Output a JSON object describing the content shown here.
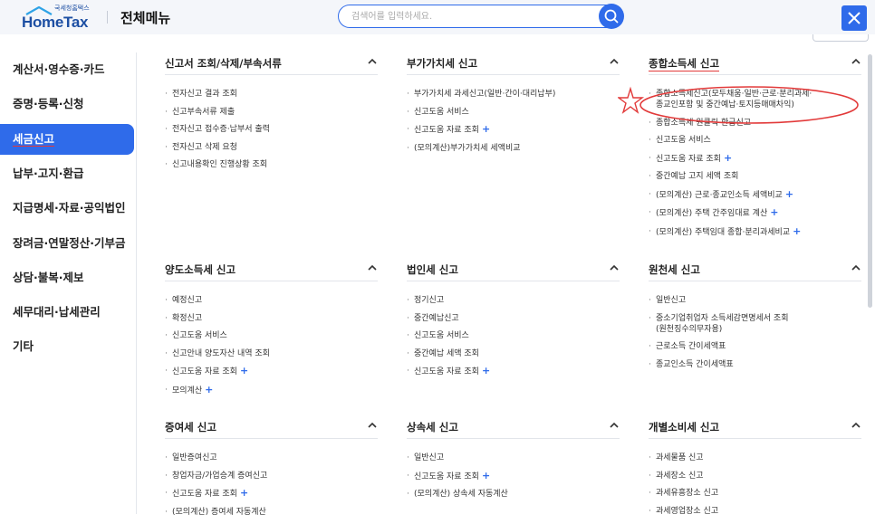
{
  "header": {
    "logo_sub": "국세청홈택스",
    "logo_main": "HomeTax",
    "title": "전체메뉴",
    "search_placeholder": "검색어를 입력하세요."
  },
  "sidebar": {
    "items": [
      {
        "label": "계산서·영수증·카드"
      },
      {
        "label": "증명·등록·신청"
      },
      {
        "label": "세금신고",
        "active": true
      },
      {
        "label": "납부·고지·환급"
      },
      {
        "label": "지급명세·자료·공익법인"
      },
      {
        "label": "장려금·연말정산·기부금"
      },
      {
        "label": "상담·불복·제보"
      },
      {
        "label": "세무대리·납세관리"
      },
      {
        "label": "기타"
      }
    ]
  },
  "sections": [
    {
      "title": "신고서 조회/삭제/부속서류",
      "items": [
        {
          "label": "전자신고 결과 조회"
        },
        {
          "label": "신고부속서류 제출"
        },
        {
          "label": "전자신고 접수증·납부서 출력"
        },
        {
          "label": "전자신고 삭제 요청"
        },
        {
          "label": "신고내용확인 진행상황 조회"
        }
      ]
    },
    {
      "title": "부가가치세 신고",
      "items": [
        {
          "label": "부가가치세 과세신고(일반·간이·대리납부)"
        },
        {
          "label": "신고도움 서비스"
        },
        {
          "label": "신고도움 자료 조회",
          "plus": "+"
        },
        {
          "label": "(모의계산)부가가치세 세액비교"
        }
      ]
    },
    {
      "title": "종합소득세 신고",
      "items": [
        {
          "label": "종합소득세신고(모두채움·일반·근로·분리과세·",
          "label2": "종교인포함 및 중간예납·토지등매매차익)"
        },
        {
          "label": "종합소득세 원클릭 환급신고"
        },
        {
          "label": "신고도움 서비스"
        },
        {
          "label": "신고도움 자료 조회",
          "plus": "+"
        },
        {
          "label": "중간예납 고지 세액 조회"
        },
        {
          "label": "(모의계산) 근로·종교인소득 세액비교",
          "plus": "+"
        },
        {
          "label": "(모의계산) 주택 간주임대료 계산",
          "plus": "+"
        },
        {
          "label": "(모의계산) 주택임대 종합·분리과세비교",
          "plus": "+"
        }
      ]
    },
    {
      "title": "양도소득세 신고",
      "items": [
        {
          "label": "예정신고"
        },
        {
          "label": "확정신고"
        },
        {
          "label": "신고도움 서비스"
        },
        {
          "label": "신고안내 양도자산 내역 조회"
        },
        {
          "label": "신고도움 자료 조회",
          "plus": "+"
        },
        {
          "label": "모의계산",
          "plus": "+"
        }
      ]
    },
    {
      "title": "법인세 신고",
      "items": [
        {
          "label": "정기신고"
        },
        {
          "label": "중간예납신고"
        },
        {
          "label": "신고도움 서비스"
        },
        {
          "label": "중간예납 세액 조회"
        },
        {
          "label": "신고도움 자료 조회",
          "plus": "+"
        }
      ]
    },
    {
      "title": "원천세 신고",
      "items": [
        {
          "label": "일반신고"
        },
        {
          "label": "중소기업취업자 소득세감면명세서 조회",
          "label2": "(원천징수의무자용)"
        },
        {
          "label": "근로소득 간이세액표"
        },
        {
          "label": "종교인소득 간이세액표"
        }
      ]
    },
    {
      "title": "증여세 신고",
      "items": [
        {
          "label": "일반증여신고"
        },
        {
          "label": "창업자금/가업승계 증여신고"
        },
        {
          "label": "신고도움 자료 조회",
          "plus": "+"
        },
        {
          "label": "(모의계산) 증여세 자동계산"
        }
      ]
    },
    {
      "title": "상속세 신고",
      "items": [
        {
          "label": "일반신고"
        },
        {
          "label": "신고도움 자료 조회",
          "plus": "+"
        },
        {
          "label": "(모의계산) 상속세 자동계산"
        }
      ]
    },
    {
      "title": "개별소비세 신고",
      "items": [
        {
          "label": "과세물품 신고"
        },
        {
          "label": "과세장소 신고"
        },
        {
          "label": "과세유흥장소 신고"
        },
        {
          "label": "과세영업장소 신고"
        }
      ]
    }
  ],
  "colors": {
    "accent": "#2f6bea",
    "annotation": "#e23a3a"
  },
  "icons": {
    "search": "search-icon",
    "close": "close-icon",
    "caret": "chevron-up-icon"
  }
}
